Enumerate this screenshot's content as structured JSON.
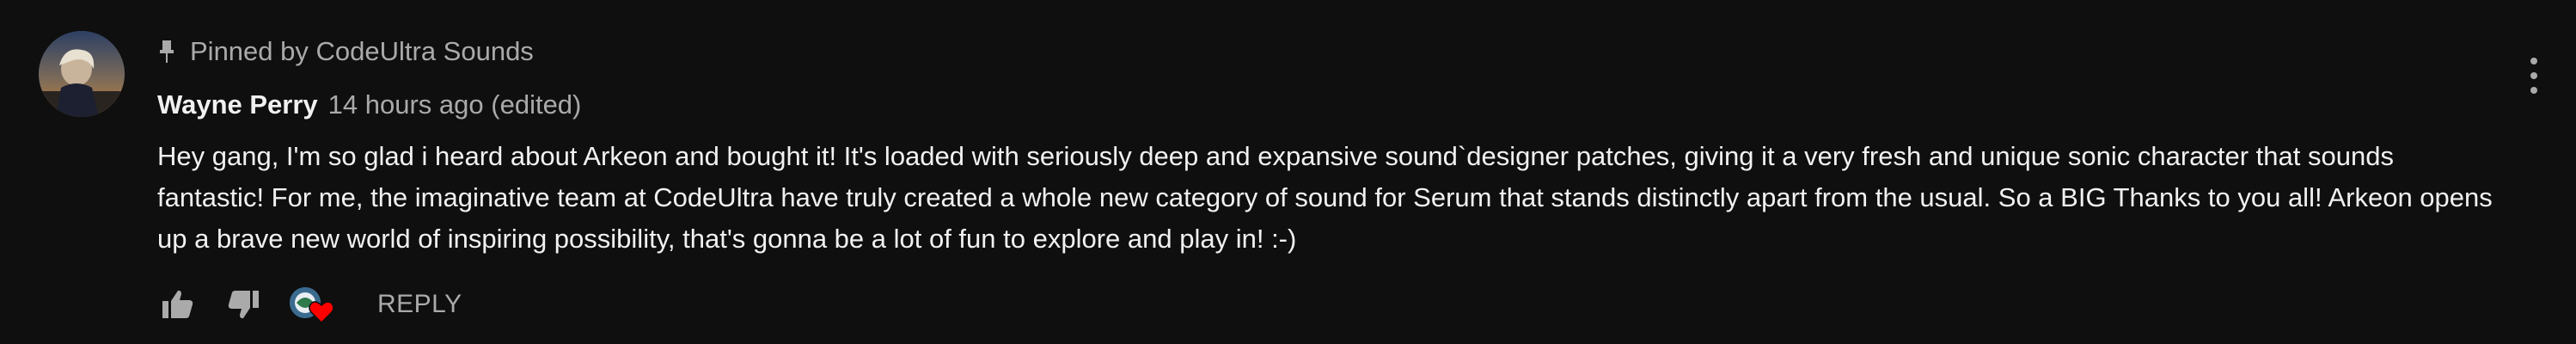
{
  "comment": {
    "pinned_text": "Pinned by CodeUltra Sounds",
    "author": "Wayne Perry",
    "timestamp": "14 hours ago (edited)",
    "body": "Hey gang, I'm so glad i heard about Arkeon and bought it! It's loaded with seriously deep and expansive sound`designer patches, giving it a very fresh and unique sonic character that sounds fantastic! For me, the imaginative team at CodeUltra have truly created a whole new category of sound for Serum that stands distinctly apart from the usual. So a BIG Thanks to you all! Arkeon opens up a brave new world of inspiring possibility, that's gonna be a lot of fun to explore and play in! :-)",
    "reply_label": "REPLY"
  },
  "icons": {
    "pin": "pin-icon",
    "like": "thumbs-up-icon",
    "dislike": "thumbs-down-icon",
    "creator_heart": "creator-heart-icon",
    "more": "more-vert-icon"
  },
  "colors": {
    "background": "#0f0f0f",
    "primary_text": "#f1f1f1",
    "secondary_text": "#aaaaaa",
    "heart": "#ff0000"
  }
}
